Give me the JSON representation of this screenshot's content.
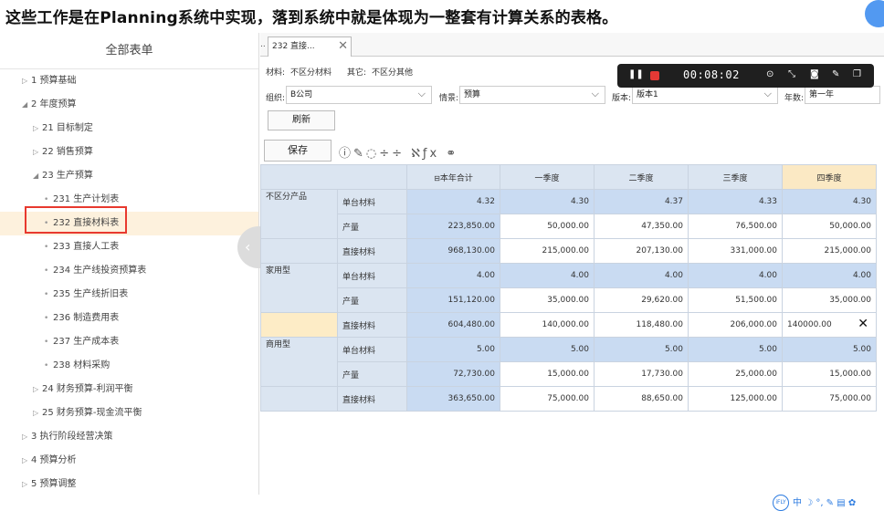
{
  "caption": "这些工作是在Planning系统中实现，落到系统中就是体现为一整套有计算关系的表格。",
  "sidebar": {
    "title": "全部表单",
    "items": [
      {
        "label": "1 预算基础",
        "level": 0,
        "state": "collapsed"
      },
      {
        "label": "2 年度预算",
        "level": 0,
        "state": "expanded"
      },
      {
        "label": "21 目标制定",
        "level": 1,
        "state": "collapsed"
      },
      {
        "label": "22 销售预算",
        "level": 1,
        "state": "collapsed"
      },
      {
        "label": "23 生产预算",
        "level": 1,
        "state": "expanded"
      },
      {
        "label": "231 生产计划表",
        "level": 2,
        "state": "leaf"
      },
      {
        "label": "232 直接材料表",
        "level": 2,
        "state": "leaf",
        "selected": true
      },
      {
        "label": "233 直接人工表",
        "level": 2,
        "state": "leaf"
      },
      {
        "label": "234 生产线投资预算表",
        "level": 2,
        "state": "leaf"
      },
      {
        "label": "235 生产线折旧表",
        "level": 2,
        "state": "leaf"
      },
      {
        "label": "236 制造费用表",
        "level": 2,
        "state": "leaf"
      },
      {
        "label": "237 生产成本表",
        "level": 2,
        "state": "leaf"
      },
      {
        "label": "238 材料采购",
        "level": 2,
        "state": "leaf"
      },
      {
        "label": "24 财务预算-利润平衡",
        "level": 1,
        "state": "collapsed"
      },
      {
        "label": "25 财务预算-现金流平衡",
        "level": 1,
        "state": "collapsed"
      },
      {
        "label": "3 执行阶段经营决策",
        "level": 0,
        "state": "collapsed"
      },
      {
        "label": "4 预算分析",
        "level": 0,
        "state": "collapsed"
      },
      {
        "label": "5 预算调整",
        "level": 0,
        "state": "collapsed"
      }
    ]
  },
  "tab": {
    "prefix": "..",
    "label": "232 直接...",
    "close": "✕"
  },
  "info": {
    "material_label": "材料:",
    "material_value": "不区分材料",
    "other_label": "其它:",
    "other_value": "不区分其他"
  },
  "filters": {
    "org_label": "组织:",
    "org_value": "B公司",
    "scenario_label": "情景:",
    "scenario_value": "预算",
    "version_label": "版本:",
    "version_value": "版本1",
    "year_label": "年数:",
    "year_value": "第一年"
  },
  "buttons": {
    "refresh": "刷新",
    "save": "保存"
  },
  "grid": {
    "headers": [
      "本年合计",
      "一季度",
      "二季度",
      "三季度",
      "四季度"
    ],
    "total_prefix": "⊟",
    "groups": [
      {
        "name": "不区分产品",
        "rows": [
          {
            "label": "单台材料",
            "values": [
              "4.32",
              "4.30",
              "4.37",
              "4.33",
              "4.30"
            ],
            "shade": true
          },
          {
            "label": "产量",
            "values": [
              "223,850.00",
              "50,000.00",
              "47,350.00",
              "76,500.00",
              "50,000.00"
            ],
            "shade": false
          },
          {
            "label": "直接材料",
            "values": [
              "968,130.00",
              "215,000.00",
              "207,130.00",
              "331,000.00",
              "215,000.00"
            ],
            "shade": false
          }
        ]
      },
      {
        "name": "家用型",
        "rows": [
          {
            "label": "单台材料",
            "values": [
              "4.00",
              "4.00",
              "4.00",
              "4.00",
              "4.00"
            ],
            "shade": true
          },
          {
            "label": "产量",
            "values": [
              "151,120.00",
              "35,000.00",
              "29,620.00",
              "51,500.00",
              "35,000.00"
            ],
            "shade": false
          },
          {
            "label": "直接材料",
            "values": [
              "604,480.00",
              "140,000.00",
              "118,480.00",
              "206,000.00",
              "140000.00"
            ],
            "shade": false,
            "editing": true
          }
        ]
      },
      {
        "name": "商用型",
        "rows": [
          {
            "label": "单台材料",
            "values": [
              "5.00",
              "5.00",
              "5.00",
              "5.00",
              "5.00"
            ],
            "shade": true
          },
          {
            "label": "产量",
            "values": [
              "72,730.00",
              "15,000.00",
              "17,730.00",
              "25,000.00",
              "15,000.00"
            ],
            "shade": false
          },
          {
            "label": "直接材料",
            "values": [
              "363,650.00",
              "75,000.00",
              "88,650.00",
              "125,000.00",
              "75,000.00"
            ],
            "shade": false
          }
        ]
      }
    ]
  },
  "recorder": {
    "time": "00:08:02"
  },
  "ime": {
    "logo": "iFLY",
    "text": "中 ☽ °, ✎ ▤ ✿"
  },
  "colors": {
    "highlight": "#e8392e",
    "header": "#dbe5f1",
    "header_q4": "#fbe9c4",
    "total": "#c9dbf2"
  }
}
